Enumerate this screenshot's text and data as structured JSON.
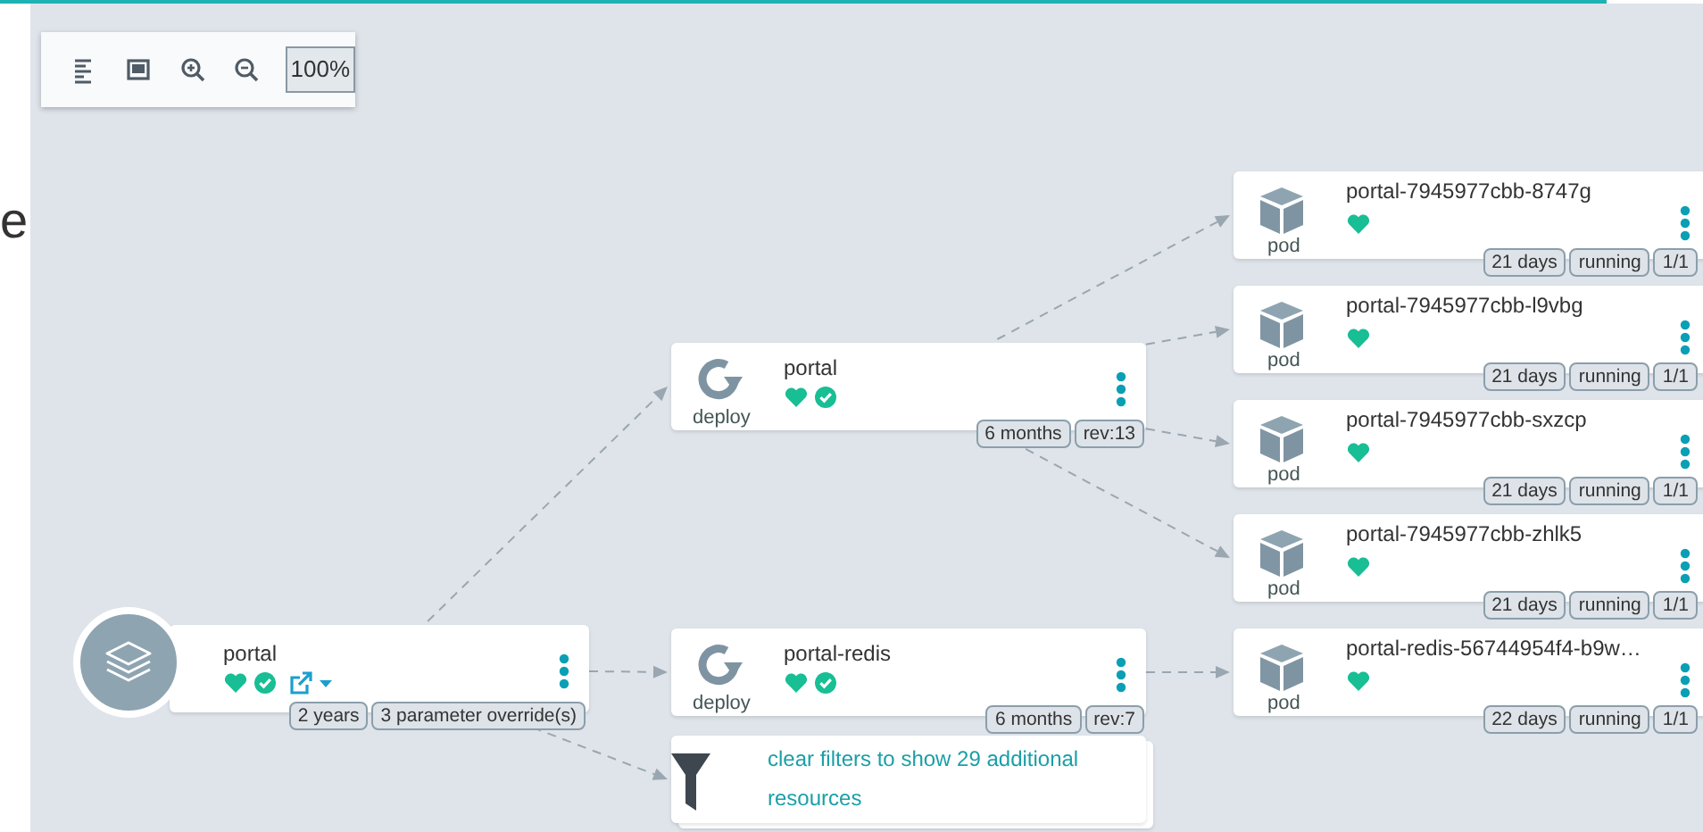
{
  "side_text": "e",
  "toolbar": {
    "buttons": [
      {
        "kind": "list"
      },
      {
        "kind": "fit"
      },
      {
        "kind": "zoom-in"
      },
      {
        "kind": "zoom-out"
      }
    ],
    "zoom": "100%"
  },
  "application": {
    "name": "portal",
    "healthy": true,
    "synced": true,
    "external_link": true,
    "dropdown": true,
    "tags": [
      "2 years",
      "3 parameter override(s)"
    ],
    "children": [
      {
        "kind": "deploy",
        "label": "deploy",
        "name": "portal",
        "healthy": true,
        "synced": true,
        "tags": [
          "6 months",
          "rev:13"
        ],
        "children": [
          {
            "kind": "pod",
            "label": "pod",
            "name": "portal-7945977cbb-8747g",
            "healthy": true,
            "tags": [
              "21 days",
              "running",
              "1/1"
            ]
          },
          {
            "kind": "pod",
            "label": "pod",
            "name": "portal-7945977cbb-l9vbg",
            "healthy": true,
            "tags": [
              "21 days",
              "running",
              "1/1"
            ]
          },
          {
            "kind": "pod",
            "label": "pod",
            "name": "portal-7945977cbb-sxzcp",
            "healthy": true,
            "tags": [
              "21 days",
              "running",
              "1/1"
            ]
          },
          {
            "kind": "pod",
            "label": "pod",
            "name": "portal-7945977cbb-zhlk5",
            "healthy": true,
            "tags": [
              "21 days",
              "running",
              "1/1"
            ]
          }
        ]
      },
      {
        "kind": "deploy",
        "label": "deploy",
        "name": "portal-redis",
        "healthy": true,
        "synced": true,
        "tags": [
          "6 months",
          "rev:7"
        ],
        "children": [
          {
            "kind": "pod",
            "label": "pod",
            "name": "portal-redis-56744954f4-b9w…",
            "healthy": true,
            "tags": [
              "22 days",
              "running",
              "1/1"
            ]
          }
        ]
      },
      {
        "kind": "filter",
        "text": "clear filters to show 29 additional resources"
      }
    ]
  }
}
